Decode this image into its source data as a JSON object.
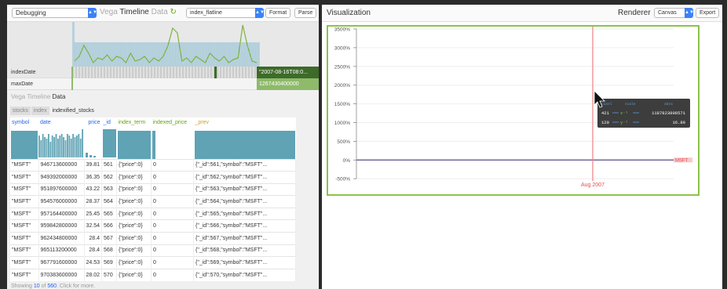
{
  "toolbar": {
    "mode_select": "Debugging",
    "brand": {
      "vega": "Vega",
      "timeline": "Timeline",
      "data": "Data"
    },
    "signal_select": "index_flatline",
    "format_label": "Format",
    "parse_label": "Parse",
    "refresh_glyph": "↻"
  },
  "timeline": {
    "rows": [
      {
        "label": "indexDate",
        "value": "\"2007-08-16T08:0...",
        "color": "#3d6b2a"
      },
      {
        "label": "maxDate",
        "value": "1267430400000",
        "color": "#8fba6a"
      }
    ]
  },
  "data_section": {
    "brand": {
      "vega": "Vega",
      "timeline": "Timeline",
      "data": "Data"
    },
    "tabs": [
      "stocks",
      "index",
      "indexified_stocks"
    ],
    "active_tab": "indexified_stocks",
    "columns": [
      {
        "name": "symbol",
        "color": "#2563eb"
      },
      {
        "name": "date",
        "color": "#2563eb"
      },
      {
        "name": "price",
        "color": "#2563eb"
      },
      {
        "name": "_id",
        "color": "#2563eb"
      },
      {
        "name": "index_term",
        "color": "#65a30d"
      },
      {
        "name": "indexed_price",
        "color": "#65a30d"
      },
      {
        "name": "_prev",
        "color": "#d4a017"
      }
    ],
    "rows": [
      [
        "\"MSFT\"",
        "946713600000",
        "39.81",
        "561",
        "{\"price\":0}",
        "0",
        "{\"_id\":561,\"symbol\":\"MSFT\"..."
      ],
      [
        "\"MSFT\"",
        "949392000000",
        "36.35",
        "562",
        "{\"price\":0}",
        "0",
        "{\"_id\":562,\"symbol\":\"MSFT\"..."
      ],
      [
        "\"MSFT\"",
        "951897600000",
        "43.22",
        "563",
        "{\"price\":0}",
        "0",
        "{\"_id\":563,\"symbol\":\"MSFT\"..."
      ],
      [
        "\"MSFT\"",
        "954576000000",
        "28.37",
        "564",
        "{\"price\":0}",
        "0",
        "{\"_id\":564,\"symbol\":\"MSFT\"..."
      ],
      [
        "\"MSFT\"",
        "957164400000",
        "25.45",
        "565",
        "{\"price\":0}",
        "0",
        "{\"_id\":565,\"symbol\":\"MSFT\"..."
      ],
      [
        "\"MSFT\"",
        "959842800000",
        "32.54",
        "566",
        "{\"price\":0}",
        "0",
        "{\"_id\":566,\"symbol\":\"MSFT\"..."
      ],
      [
        "\"MSFT\"",
        "962434800000",
        "28.4",
        "567",
        "{\"price\":0}",
        "0",
        "{\"_id\":567,\"symbol\":\"MSFT\"..."
      ],
      [
        "\"MSFT\"",
        "965113200000",
        "28.4",
        "568",
        "{\"price\":0}",
        "0",
        "{\"_id\":568,\"symbol\":\"MSFT\"..."
      ],
      [
        "\"MSFT\"",
        "967791600000",
        "24.53",
        "569",
        "{\"price\":0}",
        "0",
        "{\"_id\":569,\"symbol\":\"MSFT\"..."
      ],
      [
        "\"MSFT\"",
        "970383600000",
        "28.02",
        "570",
        "{\"price\":0}",
        "0",
        "{\"_id\":570,\"symbol\":\"MSFT\"..."
      ]
    ],
    "footer": {
      "prefix": "Showing",
      "shown": "10",
      "of": "of",
      "total": "560",
      "suffix": ". Click for more."
    }
  },
  "visualization": {
    "title": "Visualization",
    "renderer_label": "Renderer",
    "renderer_value": "Canvas",
    "export_label": "Export",
    "y_ticks": [
      "3500%",
      "3000%",
      "2500%",
      "2000%",
      "1500%",
      "1000%",
      "500%",
      "0%",
      "-500%"
    ],
    "x_label": "Aug 2007",
    "series_label": "MSFT",
    "tooltip": {
      "header": [
        "pixel",
        "scale",
        "data"
      ],
      "rows": [
        {
          "a": "421",
          "sym": "x⁻¹",
          "v": "1187823908571"
        },
        {
          "a": "120",
          "sym": "y⁻¹",
          "v": "16.89"
        }
      ]
    }
  },
  "colors": {
    "accent": "#3b82f6",
    "viz_border": "#8bc34a",
    "indicator": "#f08080",
    "hist_bar": "#5fa3b5",
    "timeline_bar": "#a8cbd9",
    "timeline_line": "#7cb342"
  }
}
